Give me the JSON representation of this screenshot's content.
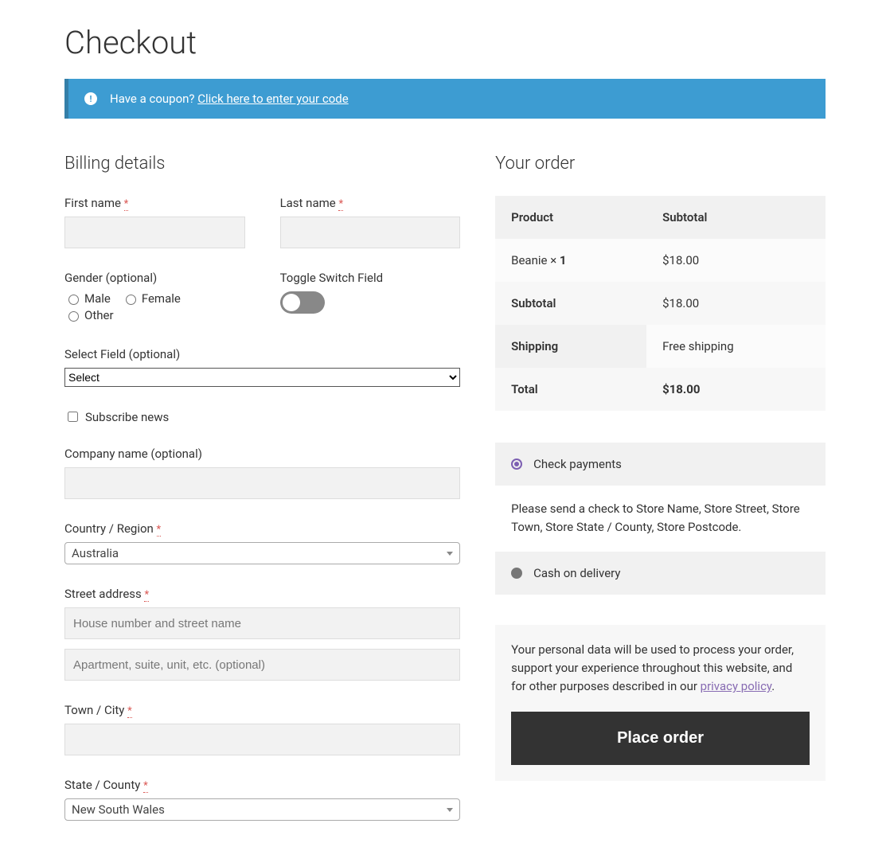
{
  "page": {
    "title": "Checkout"
  },
  "notice": {
    "prefix": "Have a coupon? ",
    "link": "Click here to enter your code"
  },
  "billing": {
    "heading": "Billing details",
    "first_name": {
      "label": "First name ",
      "value": ""
    },
    "last_name": {
      "label": "Last name ",
      "value": ""
    },
    "gender": {
      "label": "Gender (optional)",
      "options": [
        "Male",
        "Female",
        "Other"
      ]
    },
    "toggle": {
      "label": "Toggle Switch Field",
      "on": false
    },
    "select_field": {
      "label": "Select Field (optional)",
      "placeholder": "Select"
    },
    "subscribe": {
      "label": "Subscribe news",
      "checked": false
    },
    "company": {
      "label": "Company name (optional)",
      "value": ""
    },
    "country": {
      "label": "Country / Region ",
      "value": "Australia"
    },
    "street": {
      "label": "Street address ",
      "placeholder1": "House number and street name",
      "placeholder2": "Apartment, suite, unit, etc. (optional)",
      "value1": "",
      "value2": ""
    },
    "city": {
      "label": "Town / City ",
      "value": ""
    },
    "state": {
      "label": "State / County ",
      "value": "New South Wales"
    },
    "required_mark": "*"
  },
  "order": {
    "heading": "Your order",
    "columns": {
      "product": "Product",
      "subtotal": "Subtotal"
    },
    "items": [
      {
        "name": "Beanie ",
        "qty_prefix": "× ",
        "qty": "1",
        "price": "$18.00"
      }
    ],
    "subtotal": {
      "label": "Subtotal",
      "value": "$18.00"
    },
    "shipping": {
      "label": "Shipping",
      "value": "Free shipping"
    },
    "total": {
      "label": "Total",
      "value": "$18.00"
    }
  },
  "payment": {
    "methods": [
      {
        "id": "check",
        "label": "Check payments",
        "selected": true,
        "desc": "Please send a check to Store Name, Store Street, Store Town, Store State / County, Store Postcode."
      },
      {
        "id": "cod",
        "label": "Cash on delivery",
        "selected": false
      }
    ],
    "privacy_text_pre": "Your personal data will be used to process your order, support your experience throughout this website, and for other purposes described in our ",
    "privacy_link": "privacy policy",
    "privacy_text_post": ".",
    "button": "Place order"
  }
}
